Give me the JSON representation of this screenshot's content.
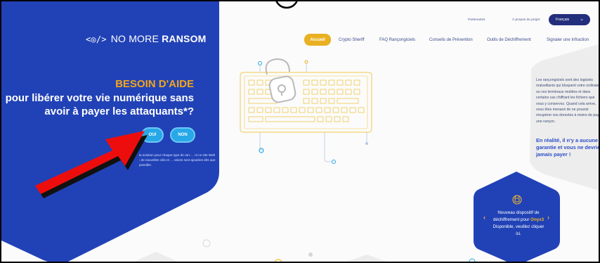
{
  "logo": {
    "glyph": "<◎/>",
    "light": "NO MORE ",
    "bold": "RANSOM"
  },
  "hero": {
    "need_help": "BESOIN D'AIDE",
    "headline": "pour libérer votre vie numérique sans avoir à payer les attaquants*?",
    "yes_label": "OUI",
    "no_label": "NON",
    "footnote": "la solution pour chaque type de ran-… nt ce site Web ; de nouvelles clés et … ations sont ajoutées dès que possible."
  },
  "top_links": {
    "partners": "Partenaires",
    "about": "À propos du projet",
    "language": "Français"
  },
  "nav": {
    "home": "Accueil",
    "crypto_sheriff": "Crypto Sheriff",
    "faq": "FAQ Rançongiciels",
    "prevention": "Conseils de Prévention",
    "decryption_tools": "Outils de Déchiffrement",
    "report": "Signaler une Infraction"
  },
  "info": {
    "text": "Les rançongiciels sont des logiciels malveillants qui bloquent votre ordinateur ou vos terminaux mobiles et dans certains cas chiffrant les fichiers que vous y conservez. Quand cela arrive, vous êtes menacé de ne pouvoir récupérer vos données à moins de payer une rançon.",
    "bold": "En réalité, il n'y a aucune garantie et vous ne devriez jamais payer !"
  },
  "decryptor": {
    "line1": "Nouveau dispositif de déchiffrement pour",
    "name": "Onyx3",
    "line2": " Disponible, veuillez cliquer ici.",
    "prev": "‹",
    "next": "›"
  },
  "colors": {
    "brand_blue": "#2142b6",
    "accent_yellow": "#e9b021",
    "button_cyan": "#27a8e8",
    "annotation_red": "#ee0d0d"
  }
}
